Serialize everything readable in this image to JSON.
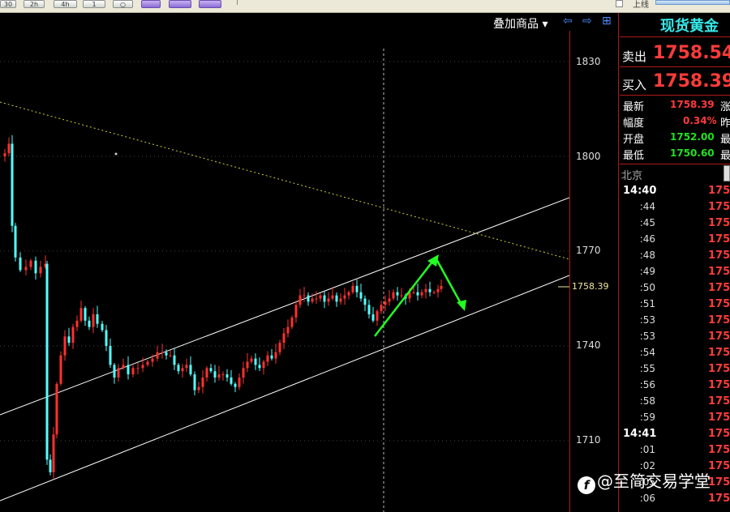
{
  "toolbar": {
    "buttons": [
      "30",
      "2h",
      "4h",
      "1",
      "○",
      "",
      "",
      ""
    ],
    "label": "上线"
  },
  "chart_header": {
    "overlay_label": "叠加商品 ▾",
    "nav_left": "⇦",
    "nav_right": "⇨",
    "tile": "⊞"
  },
  "chart_data": {
    "type": "candlestick",
    "y_ticks": [
      "1830",
      "1800",
      "1770",
      "1740",
      "1710"
    ],
    "y_range": [
      1700,
      1840
    ],
    "current_price": "1758.39",
    "colors": {
      "up": "#ff3030",
      "down": "#54ffff",
      "channel": "#ffffff",
      "arrow": "#22ff22",
      "resistance": "#cfcf3a"
    }
  },
  "quote_panel": {
    "title": "现货黄金",
    "sell_label": "卖出",
    "sell_value": "1758.54",
    "buy_label": "买入",
    "buy_value": "1758.39",
    "rows": [
      {
        "label": "最新",
        "value": "1758.39",
        "color": "red",
        "right_label": "涨"
      },
      {
        "label": "幅度",
        "value": "0.34%",
        "color": "red",
        "right_label": "昨"
      },
      {
        "label": "开盘",
        "value": "1752.00",
        "color": "green",
        "right_label": "最"
      },
      {
        "label": "最低",
        "value": "1750.60",
        "color": "green",
        "right_label": "最"
      }
    ],
    "region": "北京",
    "ticks": [
      {
        "time": "14:40",
        "price": "175",
        "hour": true
      },
      {
        "time": ":44",
        "price": "175"
      },
      {
        "time": ":45",
        "price": "175"
      },
      {
        "time": ":46",
        "price": "175"
      },
      {
        "time": ":48",
        "price": "175"
      },
      {
        "time": ":49",
        "price": "175"
      },
      {
        "time": ":50",
        "price": "175"
      },
      {
        "time": ":51",
        "price": "175"
      },
      {
        "time": ":53",
        "price": "175"
      },
      {
        "time": ":53",
        "price": "175"
      },
      {
        "time": ":54",
        "price": "175"
      },
      {
        "time": ":55",
        "price": "175"
      },
      {
        "time": ":56",
        "price": "175"
      },
      {
        "time": ":58",
        "price": "175"
      },
      {
        "time": ":59",
        "price": "175"
      },
      {
        "time": "14:41",
        "price": "175",
        "hour": true
      },
      {
        "time": ":01",
        "price": "175"
      },
      {
        "time": ":02",
        "price": "175"
      },
      {
        "time": ":05",
        "price": "175"
      },
      {
        "time": ":06",
        "price": "175"
      }
    ]
  },
  "watermark": {
    "icon": "f",
    "text": "@至简交易学堂"
  }
}
